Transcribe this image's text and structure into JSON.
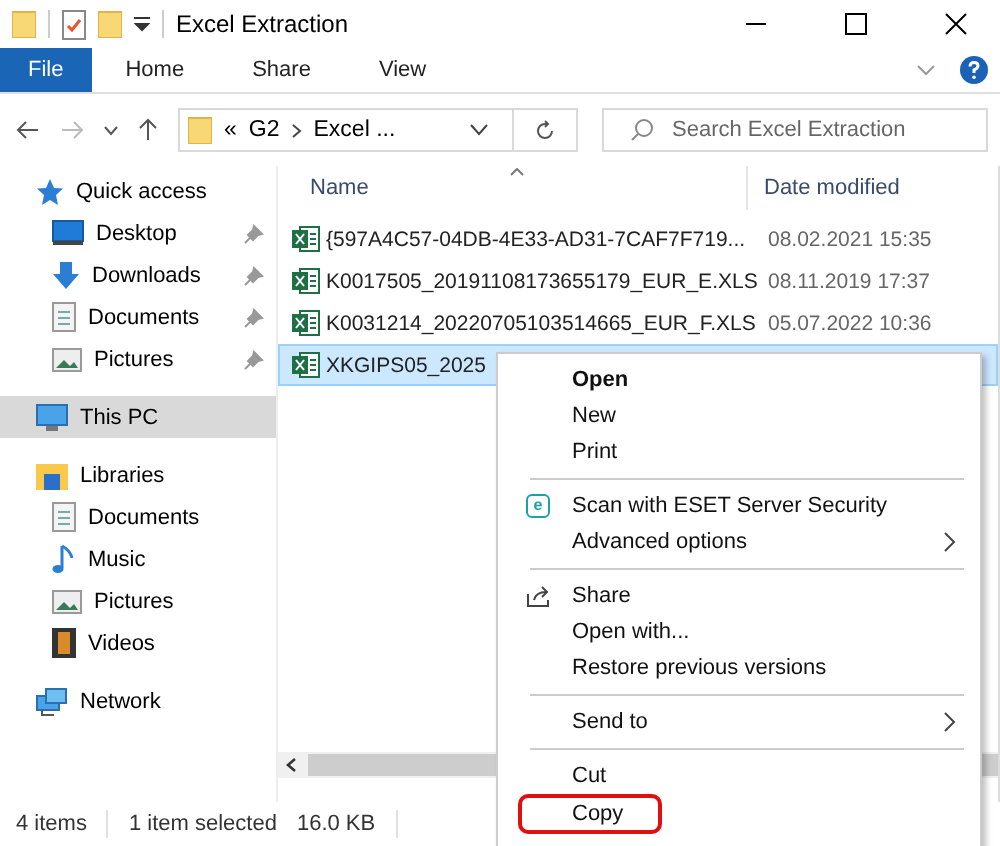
{
  "window": {
    "title": "Excel Extraction"
  },
  "ribbon_tabs": [
    {
      "label": "File",
      "selected": true
    },
    {
      "label": "Home",
      "selected": false
    },
    {
      "label": "Share",
      "selected": false
    },
    {
      "label": "View",
      "selected": false
    }
  ],
  "address": {
    "overflow": "«",
    "parts": [
      "G2",
      "Excel ..."
    ]
  },
  "search": {
    "placeholder": "Search Excel Extraction"
  },
  "sidebar": [
    {
      "label": "Quick access",
      "kind": "star",
      "selected": false,
      "children": [
        {
          "label": "Desktop",
          "kind": "desktop",
          "pinned": true,
          "selected": false
        },
        {
          "label": "Downloads",
          "kind": "downloads",
          "pinned": true,
          "selected": false
        },
        {
          "label": "Documents",
          "kind": "documents",
          "pinned": true,
          "selected": false
        },
        {
          "label": "Pictures",
          "kind": "pictures",
          "pinned": true,
          "selected": false
        }
      ]
    },
    {
      "label": "This PC",
      "kind": "pc",
      "selected": true
    },
    {
      "label": "Libraries",
      "kind": "libraries",
      "selected": false,
      "children": [
        {
          "label": "Documents",
          "kind": "documents",
          "pinned": false,
          "selected": false
        },
        {
          "label": "Music",
          "kind": "music",
          "pinned": false,
          "selected": false
        },
        {
          "label": "Pictures",
          "kind": "pictures",
          "pinned": false,
          "selected": false
        },
        {
          "label": "Videos",
          "kind": "videos",
          "pinned": false,
          "selected": false
        }
      ]
    },
    {
      "label": "Network",
      "kind": "network",
      "selected": false
    }
  ],
  "columns": [
    "Name",
    "Date modified"
  ],
  "files": [
    {
      "name": "{597A4C57-04DB-4E33-AD31-7CAF7F719...",
      "date": "08.02.2021 15:35",
      "selected": false
    },
    {
      "name": "K0017505_20191108173655179_EUR_E.XLS",
      "date": "08.11.2019 17:37",
      "selected": false
    },
    {
      "name": "K0031214_20220705103514665_EUR_F.XLS",
      "date": "05.07.2022 10:36",
      "selected": false
    },
    {
      "name": "XKGIPS05_2025",
      "selected": true
    }
  ],
  "context_menu": [
    {
      "kind": "default",
      "label": "Open"
    },
    {
      "kind": "item",
      "label": "New"
    },
    {
      "kind": "item",
      "label": "Print"
    },
    {
      "kind": "separator"
    },
    {
      "kind": "scan",
      "icon": "e",
      "label": "Scan with ESET Server Security"
    },
    {
      "kind": "submenu",
      "label": "Advanced options"
    },
    {
      "kind": "separator"
    },
    {
      "kind": "share",
      "label": "Share"
    },
    {
      "kind": "item",
      "label": "Open with..."
    },
    {
      "kind": "item",
      "label": "Restore previous versions"
    },
    {
      "kind": "separator"
    },
    {
      "kind": "submenu",
      "label": "Send to"
    },
    {
      "kind": "separator"
    },
    {
      "kind": "item",
      "label": "Cut"
    },
    {
      "kind": "marked",
      "label": "Copy"
    }
  ],
  "status_bar": {
    "count": "4 items",
    "selection": "1 item selected",
    "size": "16.0 KB"
  }
}
